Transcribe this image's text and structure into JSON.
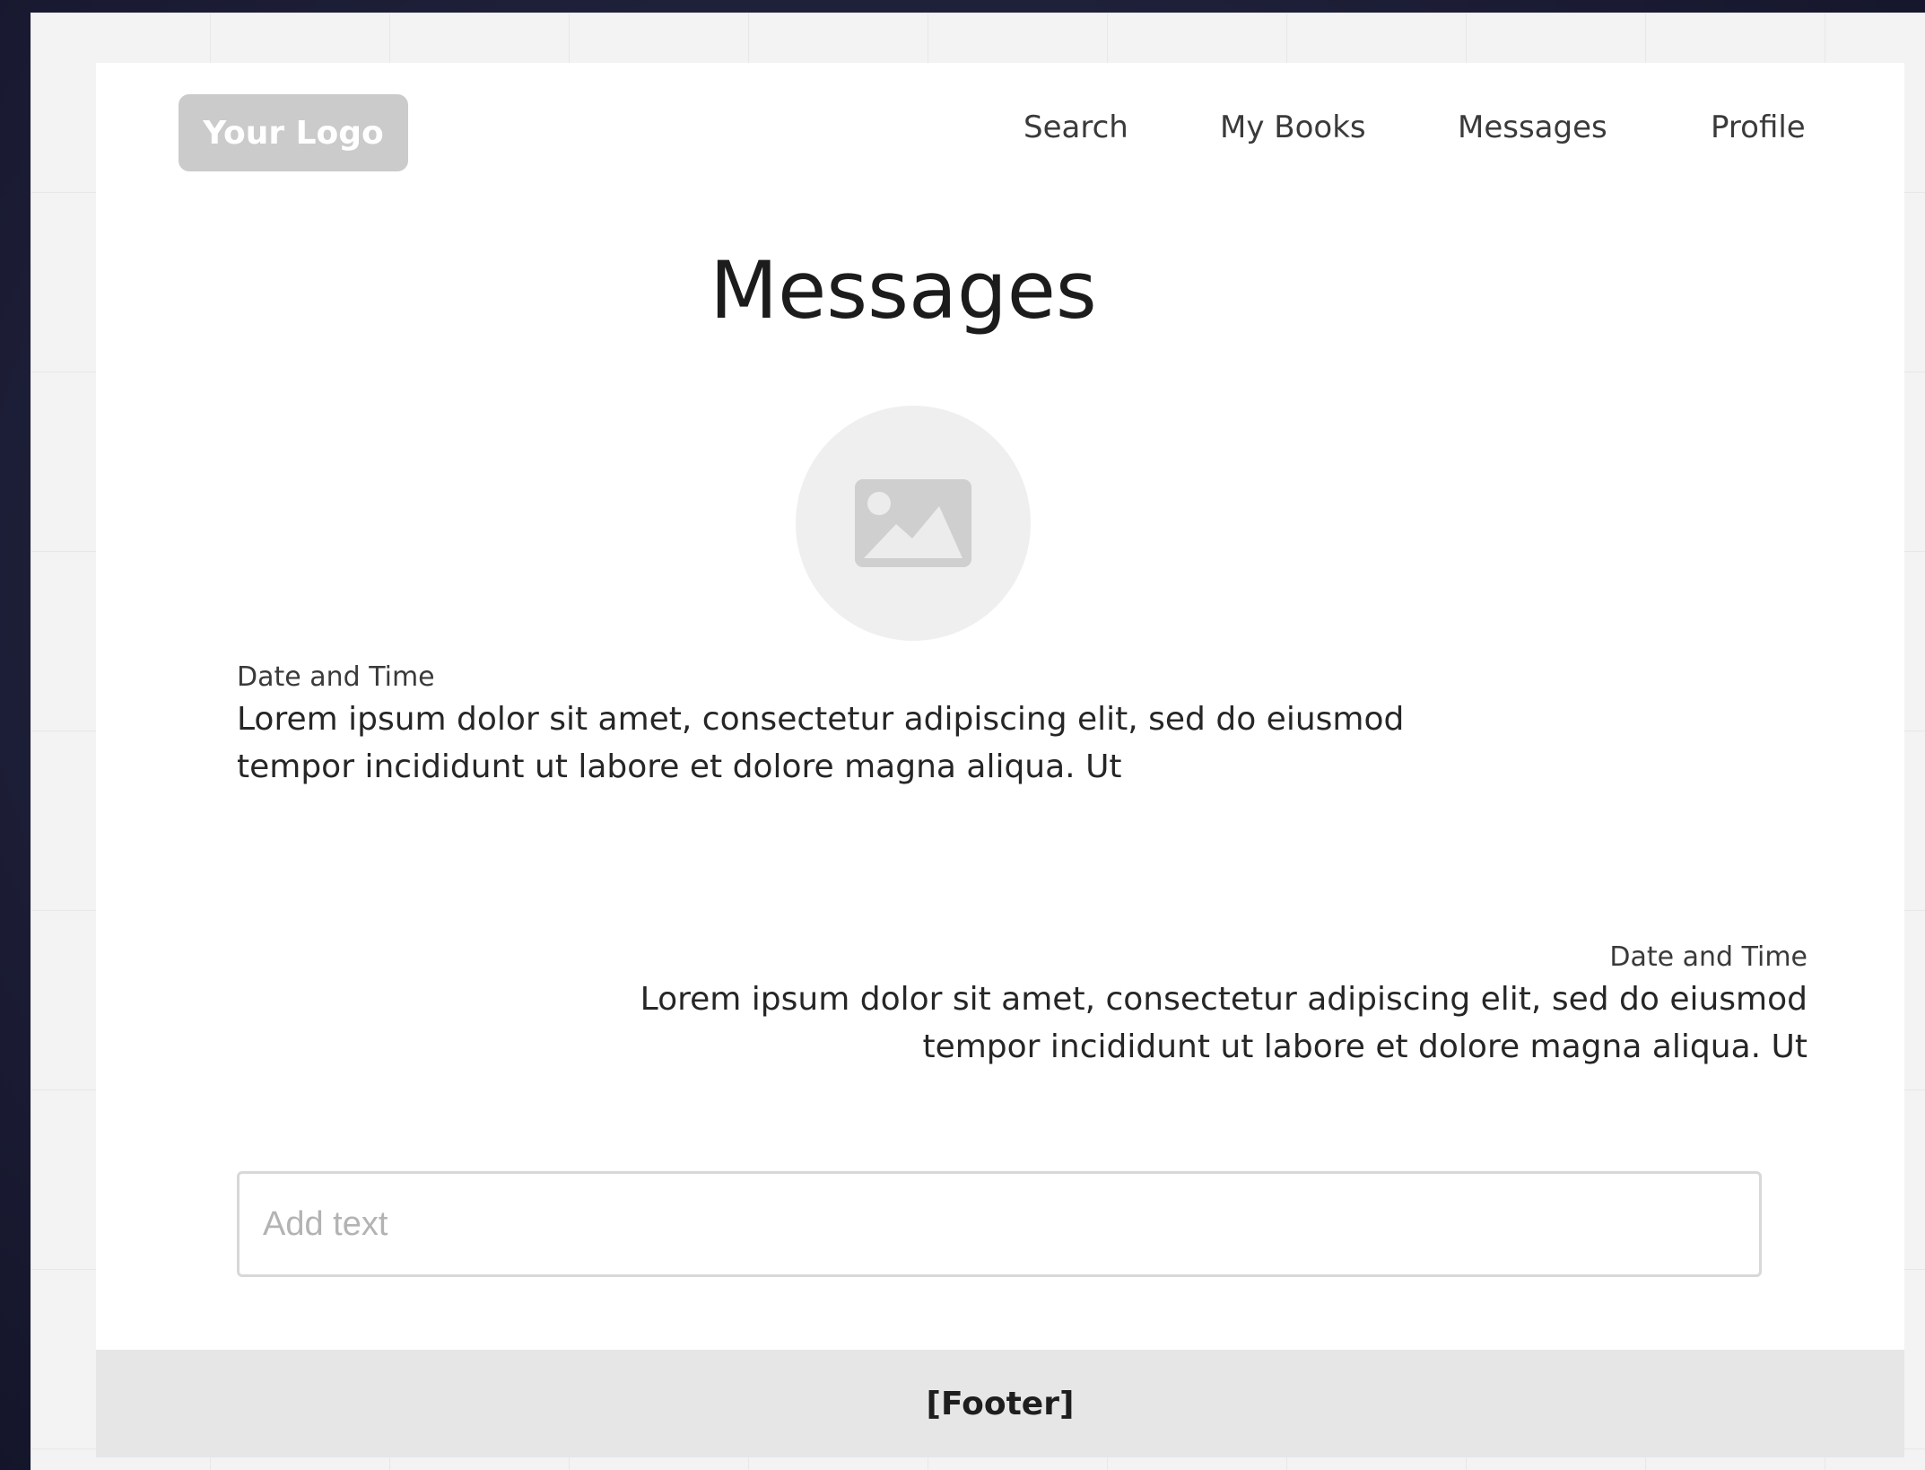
{
  "header": {
    "logo_label": "Your Logo",
    "nav": {
      "search": "Search",
      "my_books": "My Books",
      "messages": "Messages",
      "profile": "Profile"
    }
  },
  "main": {
    "title": "Messages",
    "avatar_icon": "image-placeholder-icon",
    "messages": [
      {
        "time": "Date and Time",
        "line1": "Lorem ipsum dolor sit amet, consectetur adipiscing elit, sed do eiusmod",
        "line2": "tempor incididunt ut labore et dolore magna aliqua. Ut"
      },
      {
        "time": "Date and Time",
        "line1": "Lorem ipsum dolor sit amet, consectetur adipiscing elit, sed do eiusmod",
        "line2": "tempor incididunt ut labore et dolore magna aliqua. Ut"
      }
    ],
    "input": {
      "value": "",
      "placeholder": "Add text"
    }
  },
  "footer": {
    "label": "[Footer]"
  },
  "colors": {
    "page_background": "#ffffff",
    "logo_background": "#cbcbcb",
    "footer_background": "#e6e6e6",
    "outer_background": "#1d1e37"
  }
}
